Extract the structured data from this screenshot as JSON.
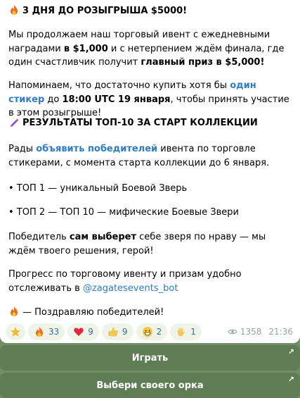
{
  "post": {
    "heading1": "3 ДНЯ ДО РОЗЫГРЫША $5000!",
    "p1": {
      "a": "Мы продолжаем наш торговый ивент с ежедневными наградами ",
      "b": "в $1,000",
      "c": " и с нетерпением ждём финала, где один счастливчик получит ",
      "d": "главный приз в $5,000!"
    },
    "p2": {
      "a": "Напоминаем, что достаточно купить хотя бы ",
      "link": "один стикер",
      "b": " до ",
      "c": "18:00 UTC 19 января",
      "d": ", чтобы принять участие в этом розыгрыше!"
    },
    "heading2": "РЕЗУЛЬТАТЫ ТОП-10 ЗА СТАРТ КОЛЛЕКЦИИ",
    "p3": {
      "a": "Рады ",
      "link": "объявить победителей",
      "b": " ивента по торговле стикерами, с момента старта коллекции до 6 января."
    },
    "top1": "• ТОП 1 — уникальный Боевой Зверь",
    "top2": "• ТОП 2 — ТОП 10 — мифические Боевые Звери",
    "p4": {
      "a": "Победитель ",
      "b": "сам выберет",
      "c": " себе зверя по нраву — мы ждём твоего решения, герой!"
    },
    "p5": {
      "a": "Прогресс по торговому ивенту и призам удобно отслеживать в ",
      "link": "@zagatesevents_bot"
    },
    "congrats": "— Поздравляю победителей!"
  },
  "reactions": [
    {
      "icon": "star-icon",
      "count": ""
    },
    {
      "icon": "fire-icon",
      "count": "33"
    },
    {
      "icon": "heart-icon",
      "count": "9"
    },
    {
      "icon": "thumbs-up-icon",
      "count": "9"
    },
    {
      "icon": "grin-icon",
      "count": "2"
    },
    {
      "icon": "clap-icon",
      "count": "1"
    }
  ],
  "meta": {
    "views": "1358",
    "time": "21:36"
  },
  "buttons": {
    "play": "Играть",
    "choose_orc": "Выбери своего орка"
  }
}
